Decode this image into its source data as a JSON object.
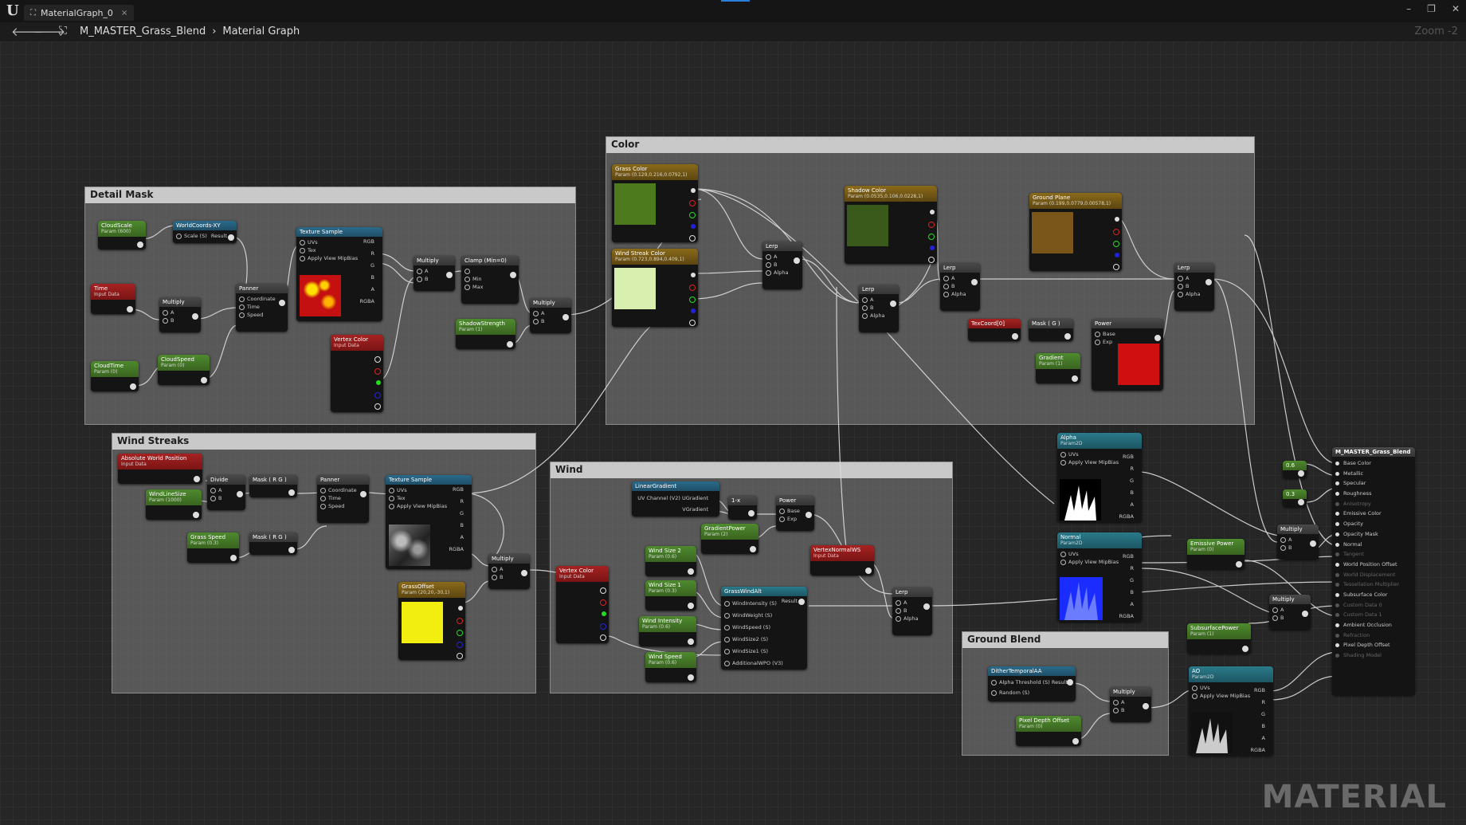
{
  "window": {
    "tab_label": "MaterialGraph_0",
    "tab_close": "×",
    "minimize": "–",
    "restore": "❐",
    "close": "✕"
  },
  "nav": {
    "back": "🡐",
    "forward": "🡒",
    "breadcrumb": [
      "M_MASTER_Grass_Blend",
      "Material Graph"
    ],
    "separator": "›",
    "zoom": "Zoom -2"
  },
  "comments": {
    "detail_mask": "Detail Mask",
    "color": "Color",
    "wind_streaks": "Wind Streaks",
    "wind": "Wind",
    "ground_blend": "Ground Blend"
  },
  "nodes": {
    "cloud_scale": {
      "title": "CloudScale",
      "sub": "Param (600)"
    },
    "worldcoords": {
      "title": "WorldCoords-XY",
      "pin": "Scale (S)",
      "out": "Result"
    },
    "time": {
      "title": "Time",
      "sub": "Input Data"
    },
    "multiply1": {
      "title": "Multiply",
      "a": "A",
      "b": "B"
    },
    "panner1": {
      "title": "Panner",
      "p1": "Coordinate",
      "p2": "Time",
      "p3": "Speed"
    },
    "cloud_time": {
      "title": "CloudTime",
      "sub": "Param (0)"
    },
    "cloud_speed": {
      "title": "CloudSpeed",
      "sub": "Param (0)"
    },
    "texsample1": {
      "title": "Texture Sample",
      "uvs": "UVs",
      "tex": "Tex",
      "mip": "Apply View MipBias",
      "rgb": "RGB",
      "r": "R",
      "g": "G",
      "b": "B",
      "a": "A",
      "rgba": "RGBA"
    },
    "vertex_color1": {
      "title": "Vertex Color",
      "sub": "Input Data"
    },
    "multiply2": {
      "title": "Multiply",
      "a": "A",
      "b": "B"
    },
    "clamp": {
      "title": "Clamp (Min=0)",
      "min": "Min",
      "max": "Max"
    },
    "shadow_strength": {
      "title": "ShadowStrength",
      "sub": "Param (1)"
    },
    "multiply3": {
      "title": "Multiply",
      "a": "A",
      "b": "B"
    },
    "grass_color": {
      "title": "Grass Color",
      "sub": "Param (0.129,0.216,0.0792,1)"
    },
    "wind_streak_color": {
      "title": "Wind Streak Color",
      "sub": "Param (0.723,0.894,0.409,1)"
    },
    "lerp1": {
      "title": "Lerp",
      "a": "A",
      "b": "B",
      "alpha": "Alpha"
    },
    "shadow_color": {
      "title": "Shadow Color",
      "sub": "Param (0.0535,0.106,0.0228,1)"
    },
    "lerp2": {
      "title": "Lerp",
      "a": "A",
      "b": "B",
      "alpha": "Alpha"
    },
    "lerp3": {
      "title": "Lerp",
      "a": "A",
      "b": "B",
      "alpha": "Alpha"
    },
    "ground_plane": {
      "title": "Ground Plane",
      "sub": "Param (0.199,0.0779,0.00578,1)"
    },
    "lerp4": {
      "title": "Lerp",
      "a": "A",
      "b": "B",
      "alpha": "Alpha"
    },
    "texcoord": {
      "title": "TexCoord[0]"
    },
    "mask_g": {
      "title": "Mask ( G )"
    },
    "power1": {
      "title": "Power",
      "base": "Base",
      "exp": "Exp"
    },
    "gradient": {
      "title": "Gradient",
      "sub": "Param (1)"
    },
    "abs_world_pos": {
      "title": "Absolute World Position",
      "sub": "Input Data"
    },
    "divide": {
      "title": "Divide",
      "a": "A",
      "b": "B"
    },
    "mask_rg1": {
      "title": "Mask ( R G )"
    },
    "wind_line_size": {
      "title": "WindLineSize",
      "sub": "Param (1000)"
    },
    "panner2": {
      "title": "Panner",
      "p1": "Coordinate",
      "p2": "Time",
      "p3": "Speed"
    },
    "grass_speed": {
      "title": "Grass Speed",
      "sub": "Param (0.3)"
    },
    "mask_rg2": {
      "title": "Mask ( R G )"
    },
    "texsample2": {
      "title": "Texture Sample",
      "uvs": "UVs",
      "tex": "Tex",
      "mip": "Apply View MipBias",
      "rgb": "RGB",
      "r": "R",
      "g": "G",
      "b": "B",
      "a": "A",
      "rgba": "RGBA"
    },
    "multiply4": {
      "title": "Multiply",
      "a": "A",
      "b": "B"
    },
    "grass_offset": {
      "title": "GrassOffset",
      "sub": "Param (20,20,-30,1)"
    },
    "linear_gradient": {
      "title": "LinearGradient",
      "p1": "UV Channel (V2) UGradient",
      "p2": "VGradient"
    },
    "one_minus": {
      "title": "1-x"
    },
    "power2": {
      "title": "Power",
      "base": "Base",
      "exp": "Exp"
    },
    "gradient_power": {
      "title": "GradientPower",
      "sub": "Param (2)"
    },
    "wind_size2": {
      "title": "Wind Size 2",
      "sub": "Param (0.6)"
    },
    "wind_size1": {
      "title": "Wind Size 1",
      "sub": "Param (0.3)"
    },
    "vertex_normal": {
      "title": "VertexNormalWS",
      "sub": "Input Data"
    },
    "vertex_color2": {
      "title": "Vertex Color",
      "sub": "Input Data"
    },
    "grass_wind_alt": {
      "title": "GrassWindAlt",
      "p1": "WindIntensity (S)",
      "out": "Result",
      "p2": "WindWeight (S)",
      "p3": "WindSpeed (S)",
      "p4": "WindSize2 (S)",
      "p5": "WindSize1 (S)",
      "p6": "AdditionalWPO (V3)"
    },
    "wind_intensity": {
      "title": "Wind Intensity",
      "sub": "Param (0.6)"
    },
    "wind_speed": {
      "title": "Wind Speed",
      "sub": "Param (0.6)"
    },
    "lerp5": {
      "title": "Lerp",
      "a": "A",
      "b": "B",
      "alpha": "Alpha"
    },
    "alpha_tex": {
      "title": "Alpha",
      "sub": "Param2D",
      "uvs": "UVs",
      "mip": "Apply View MipBias",
      "rgb": "RGB",
      "r": "R",
      "g": "G",
      "b": "B",
      "a": "A",
      "rgba": "RGBA"
    },
    "normal_tex": {
      "title": "Normal",
      "sub": "Param2D",
      "uvs": "UVs",
      "mip": "Apply View MipBias",
      "rgb": "RGB",
      "r": "R",
      "g": "G",
      "b": "B",
      "a": "A",
      "rgba": "RGBA"
    },
    "ao_tex": {
      "title": "AO",
      "sub": "Param2D",
      "uvs": "UVs",
      "mip": "Apply View MipBias",
      "rgb": "RGB",
      "r": "R",
      "g": "G",
      "b": "B",
      "a": "A",
      "rgba": "RGBA"
    },
    "emissive_power": {
      "title": "Emissive Power",
      "sub": "Param (0)"
    },
    "subsurface_power": {
      "title": "SubsurfacePower",
      "sub": "Param (1)"
    },
    "multiply5": {
      "title": "Multiply",
      "a": "A",
      "b": "B"
    },
    "multiply6": {
      "title": "Multiply",
      "a": "A",
      "b": "B"
    },
    "const_a": {
      "title": "0.6"
    },
    "const_b": {
      "title": "0.3"
    },
    "dither": {
      "title": "DitherTemporalAA",
      "p1": "Alpha Threshold (S) Result",
      "p2": "Random (S)"
    },
    "multiply7": {
      "title": "Multiply",
      "a": "A",
      "b": "B"
    },
    "pixel_depth_offset": {
      "title": "Pixel Depth Offset",
      "sub": "Param (0)"
    }
  },
  "final_node": {
    "title": "M_MASTER_Grass_Blend",
    "inputs": [
      {
        "label": "Base Color",
        "active": true
      },
      {
        "label": "Metallic",
        "active": true
      },
      {
        "label": "Specular",
        "active": true
      },
      {
        "label": "Roughness",
        "active": true
      },
      {
        "label": "Anisotropy",
        "active": false
      },
      {
        "label": "Emissive Color",
        "active": true
      },
      {
        "label": "Opacity",
        "active": true
      },
      {
        "label": "Opacity Mask",
        "active": true
      },
      {
        "label": "Normal",
        "active": true
      },
      {
        "label": "Tangent",
        "active": false
      },
      {
        "label": "World Position Offset",
        "active": true
      },
      {
        "label": "World Displacement",
        "active": false
      },
      {
        "label": "Tessellation Multiplier",
        "active": false
      },
      {
        "label": "Subsurface Color",
        "active": true
      },
      {
        "label": "Custom Data 0",
        "active": false
      },
      {
        "label": "Custom Data 1",
        "active": false
      },
      {
        "label": "Ambient Occlusion",
        "active": true
      },
      {
        "label": "Refraction",
        "active": false
      },
      {
        "label": "Pixel Depth Offset",
        "active": true
      },
      {
        "label": "Shading Model",
        "active": false
      }
    ]
  },
  "colors": {
    "grass": "#4e7a1e",
    "wind_streak": "#d8efb0",
    "shadow": "#3a5a1c",
    "ground": "#7a561a",
    "power_red": "#d01010",
    "grass_offset": "#f2ee10",
    "normal_blue": "#2a40ff"
  },
  "watermark": "MATERIAL"
}
